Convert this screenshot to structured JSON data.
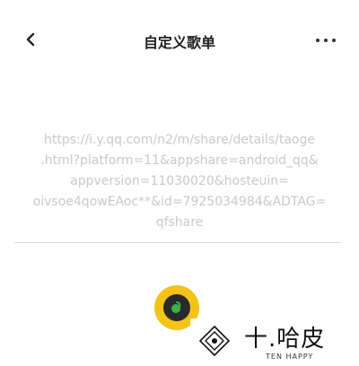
{
  "header": {
    "title": "自定义歌单"
  },
  "url_input": {
    "lines": [
      "https://i.y.qq.com/n2/m/share/details/taoge",
      ".html?platform=11&appshare=android_qq&",
      "appversion=11030020&hosteuin=",
      "oivsoe4qowEAoc**&id=7925034984&ADTAG=",
      "qfshare"
    ]
  },
  "watermark": {
    "name": "十.哈皮",
    "sub": "TEN HAPPY"
  },
  "colors": {
    "accent": "#f3c318",
    "url_text": "#c9c9c9"
  }
}
